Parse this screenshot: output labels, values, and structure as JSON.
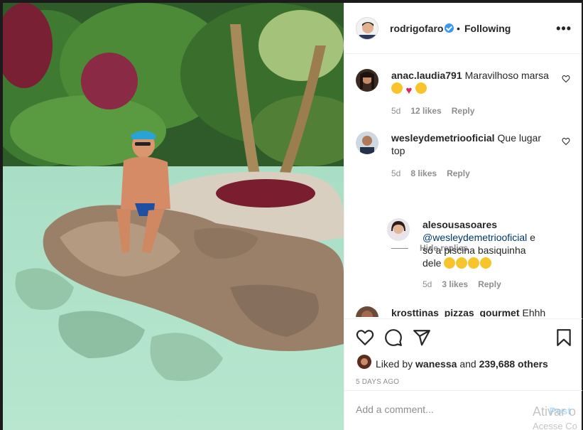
{
  "header": {
    "username": "rodrigofaro",
    "separator": "•",
    "follow_status": "Following",
    "more": "•••"
  },
  "comments": [
    {
      "user": "anac.laudia791",
      "text": "Maravilhoso marsa",
      "time": "5d",
      "likes": "12 likes",
      "reply": "Reply"
    },
    {
      "user": "wesleydemetriooficial",
      "text": "Que lugar top",
      "time": "5d",
      "likes": "8 likes",
      "reply": "Reply"
    },
    {
      "user": "alesousasoares",
      "mention": "@wesleydemetriooficial",
      "text": "e só a piscina basiquinha dele",
      "time": "5d",
      "likes": "3 likes",
      "reply": "Reply"
    },
    {
      "user": "krosttinas_pizzas_gourmet",
      "text": "Ehhh"
    }
  ],
  "hide_replies": "Hide replies",
  "liked_by": {
    "prefix": "Liked by",
    "user": "wanessa",
    "middle": "and",
    "others": "239,688 others"
  },
  "date": "5 DAYS AGO",
  "add_comment": {
    "placeholder": "Add a comment...",
    "post_label": "Post"
  },
  "watermark": {
    "line1": "Ativar o",
    "line2": "Acesse Co"
  },
  "icons": [
    "heart-icon",
    "comment-icon",
    "share-icon",
    "bookmark-icon",
    "more-icon",
    "verified-icon"
  ],
  "colors": {
    "verified": "#3897f0",
    "link": "#00376b",
    "muted": "#8e8e8e"
  }
}
